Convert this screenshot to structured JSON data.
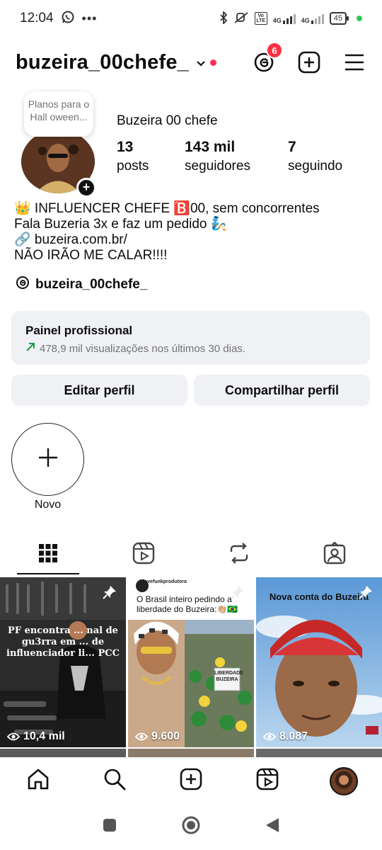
{
  "status_bar": {
    "time": "12:04",
    "net1": "4G",
    "net2": "4G",
    "battery": "45",
    "volte": "Vo LTE"
  },
  "header": {
    "username": "buzeira_00chefe_",
    "threads_badge": "6",
    "icons": [
      "threads-icon",
      "add-post-icon",
      "menu-icon"
    ]
  },
  "profile": {
    "note": "Planos para o Hall oween...",
    "display_name": "Buzeira 00 chefe",
    "stats": [
      {
        "num": "13",
        "label": "posts"
      },
      {
        "num": "143 mil",
        "label": "seguidores"
      },
      {
        "num": "7",
        "label": "seguindo"
      }
    ],
    "bio": [
      "👑 INFLUENCER CHEFE 🅱️00, sem concorrentes",
      "Fala Buzeria 3x e faz um pedido 🧞",
      "🔗 buzeira.com.br/",
      "NÃO IRÃO ME CALAR!!!!"
    ],
    "threads_handle": "buzeira_00chefe_"
  },
  "panel": {
    "title": "Painel profissional",
    "subtitle": "478,9 mil visualizações nos últimos 30 dias."
  },
  "buttons": {
    "edit": "Editar perfil",
    "share": "Compartilhar perfil"
  },
  "story": {
    "label": "Novo"
  },
  "tabs": [
    "grid-icon",
    "reels-icon",
    "reposts-icon",
    "tagged-icon"
  ],
  "posts": [
    {
      "views": "10,4 mil",
      "caption": "PF encontra ... nal de gu3rra em ... de influenciador li... PCC"
    },
    {
      "views": "9.600",
      "account": "lovefunkprodutora",
      "caption": "O Brasil inteiro pedindo a liberdade do Buzeira:👏🏼🇧🇷",
      "sign": "LIBERDADE BUZEIRA"
    },
    {
      "views": "8.087",
      "caption": "Nova conta do Buzeira"
    }
  ],
  "bottom_nav": [
    "home-icon",
    "search-icon",
    "create-icon",
    "reels-icon",
    "profile-avatar"
  ],
  "colors": {
    "accent_red": "#ff3040",
    "panel_bg": "#eff1f4",
    "trend_green": "#1a9c4a"
  }
}
